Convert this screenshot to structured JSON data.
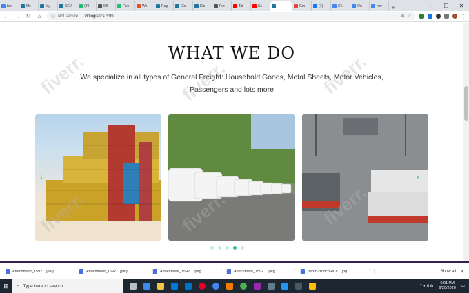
{
  "browser": {
    "tabs": [
      {
        "label": "test",
        "color": "#4285f4"
      },
      {
        "label": "Me",
        "color": "#21759b"
      },
      {
        "label": "My",
        "color": "#21759b"
      },
      {
        "label": "SEV",
        "color": "#21759b"
      },
      {
        "label": "(40",
        "color": "#1dbf73"
      },
      {
        "label": "9 B",
        "color": "#555"
      },
      {
        "label": "Five",
        "color": "#1dbf73"
      },
      {
        "label": "Wo",
        "color": "#e44d26"
      },
      {
        "label": "Pag",
        "color": "#21759b"
      },
      {
        "label": "Ele",
        "color": "#21759b"
      },
      {
        "label": "Ele",
        "color": "#21759b"
      },
      {
        "label": "Pre",
        "color": "#555"
      },
      {
        "label": "Tal",
        "color": "#ff0000"
      },
      {
        "label": "Sc",
        "color": "#ff0000"
      },
      {
        "label": "",
        "color": "#21759b",
        "active": true
      },
      {
        "label": "Gm",
        "color": "#ea4335"
      },
      {
        "label": "(7)",
        "color": "#1877f2"
      },
      {
        "label": "C:\\",
        "color": "#4285f4"
      },
      {
        "label": "Ou",
        "color": "#4285f4"
      },
      {
        "label": "hov",
        "color": "#4285f4"
      }
    ],
    "new_tab": "+",
    "window_controls": {
      "minimize": "–",
      "maximize": "☐",
      "close": "✕"
    },
    "security": "Not secure",
    "url": "vlhlogistics.com"
  },
  "page": {
    "heading": "WHAT WE DO",
    "subtitle": "We specialize in all types of General Freight: Household Goods, Metal Sheets, Motor Vehicles, Passengers and lots more",
    "slider": {
      "arrow_left": "‹",
      "arrow_right": "›",
      "dots": 5,
      "active_dot": 4
    }
  },
  "watermark": "fiverr.",
  "downloads": {
    "items": [
      "Attachment_1592....jpeg",
      "Attachment_1592....jpeg",
      "Attachment_1592....jpeg",
      "Attachment_1592....jpeg",
      "bernd-dittrich-eCc....jpg"
    ],
    "show_all": "Show all"
  },
  "taskbar": {
    "search_placeholder": "Type here to search",
    "time": "6:01 PM",
    "date": "6/20/2020"
  }
}
